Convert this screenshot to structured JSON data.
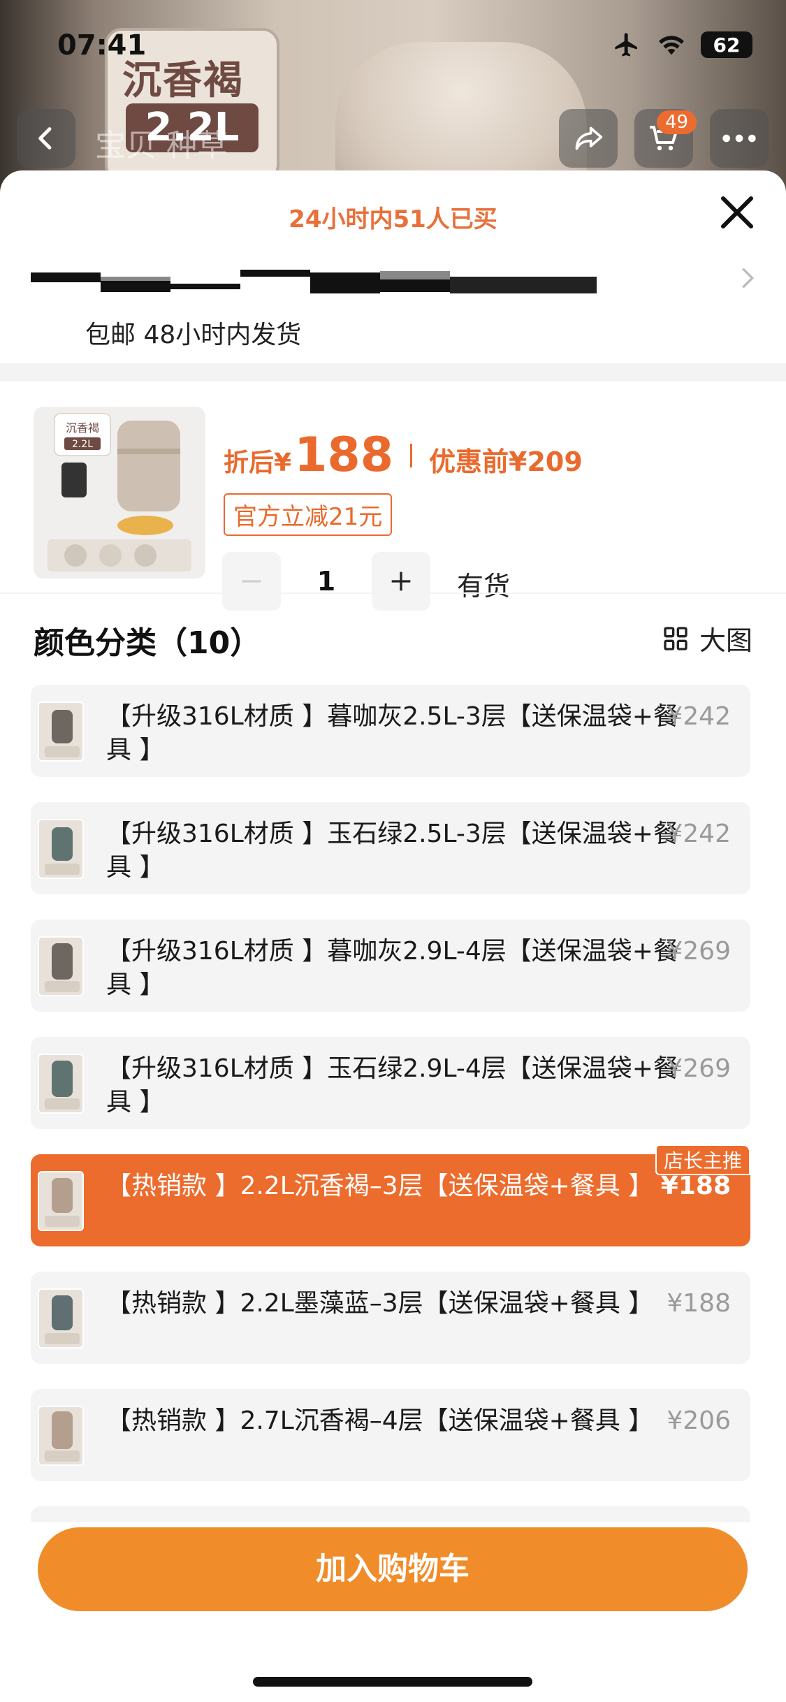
{
  "status_bar": {
    "time": "07:41",
    "battery": "62"
  },
  "background": {
    "box_title": "沉香褐",
    "box_tag": "2.2L",
    "nav_title": "宝贝  种草",
    "cart_count": "49"
  },
  "sheet": {
    "sold_banner": "24小时内51人已买",
    "shipping": "包邮 48小时内发货",
    "product": {
      "price_label": "折后",
      "currency": "¥",
      "price": "188",
      "orig_label": "优惠前",
      "orig_price": "¥209",
      "coupon": "官方立减21元",
      "quantity": "1",
      "stock": "有货",
      "thumb_tag": "沉香褐",
      "thumb_size": "2.2L"
    },
    "section_title": "颜色分类（10）",
    "big_view": "大图",
    "options": [
      {
        "text": "【升级316L材质 】暮咖灰2.5L-3层【送保温袋+餐具 】",
        "price": "¥242",
        "selected": false
      },
      {
        "text": "【升级316L材质 】玉石绿2.5L-3层【送保温袋+餐具 】",
        "price": "¥242",
        "selected": false
      },
      {
        "text": "【升级316L材质 】暮咖灰2.9L-4层【送保温袋+餐具 】",
        "price": "¥269",
        "selected": false
      },
      {
        "text": "【升级316L材质 】玉石绿2.9L-4层【送保温袋+餐具 】",
        "price": "¥269",
        "selected": false
      },
      {
        "text": "【热销款 】2.2L沉香褐–3层【送保温袋+餐具 】",
        "price": "¥188",
        "selected": true,
        "badge": "店长主推"
      },
      {
        "text": "【热销款 】2.2L墨藻蓝–3层【送保温袋+餐具 】",
        "price": "¥188",
        "selected": false
      },
      {
        "text": "【热销款 】2.7L沉香褐–4层【送保温袋+餐具 】",
        "price": "¥206",
        "selected": false
      }
    ],
    "add_to_cart": "加入购物车"
  },
  "colors": {
    "accent": "#ec6c2e",
    "button": "#f08d2a",
    "muted_price": "#9a9a9a"
  }
}
